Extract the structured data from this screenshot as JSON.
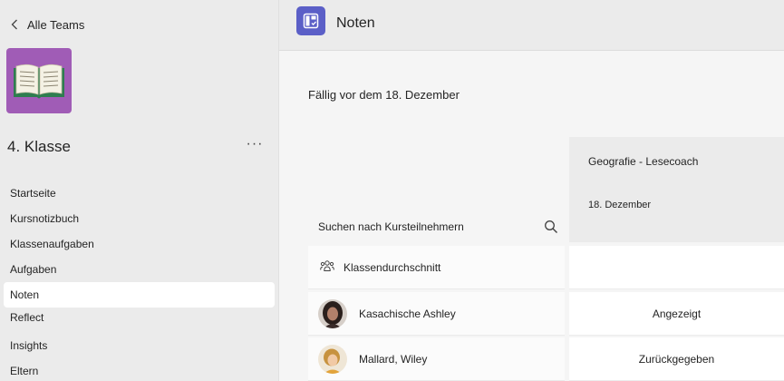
{
  "sidebar": {
    "back_label": "Alle Teams",
    "team_name": "4. Klasse",
    "more_label": "···",
    "items": [
      {
        "label": "Startseite"
      },
      {
        "label": "Kursnotizbuch"
      },
      {
        "label": "Klassenaufgaben"
      },
      {
        "label": "Aufgaben"
      },
      {
        "label": "Noten"
      },
      {
        "label": "Reflect"
      },
      {
        "label": "Insights"
      },
      {
        "label": "Eltern"
      }
    ],
    "active_item": "Noten",
    "team_tile_color": "#a05cb6"
  },
  "header": {
    "app_title": "Noten",
    "app_icon": "grades-icon",
    "accent": "#5b5fc7"
  },
  "main": {
    "due_label": "Fällig vor dem 18. Dezember",
    "assignment": {
      "title": "Geografie - Lesecoach",
      "date": "18. Dezember"
    },
    "search_label": "Suchen nach Kursteilnehmern",
    "class_average_label": "Klassendurchschnitt",
    "students": [
      {
        "name": "Kasachische Ashley",
        "status": "Angezeigt"
      },
      {
        "name": "Mallard, Wiley",
        "status": "Zurückgegeben"
      }
    ]
  }
}
